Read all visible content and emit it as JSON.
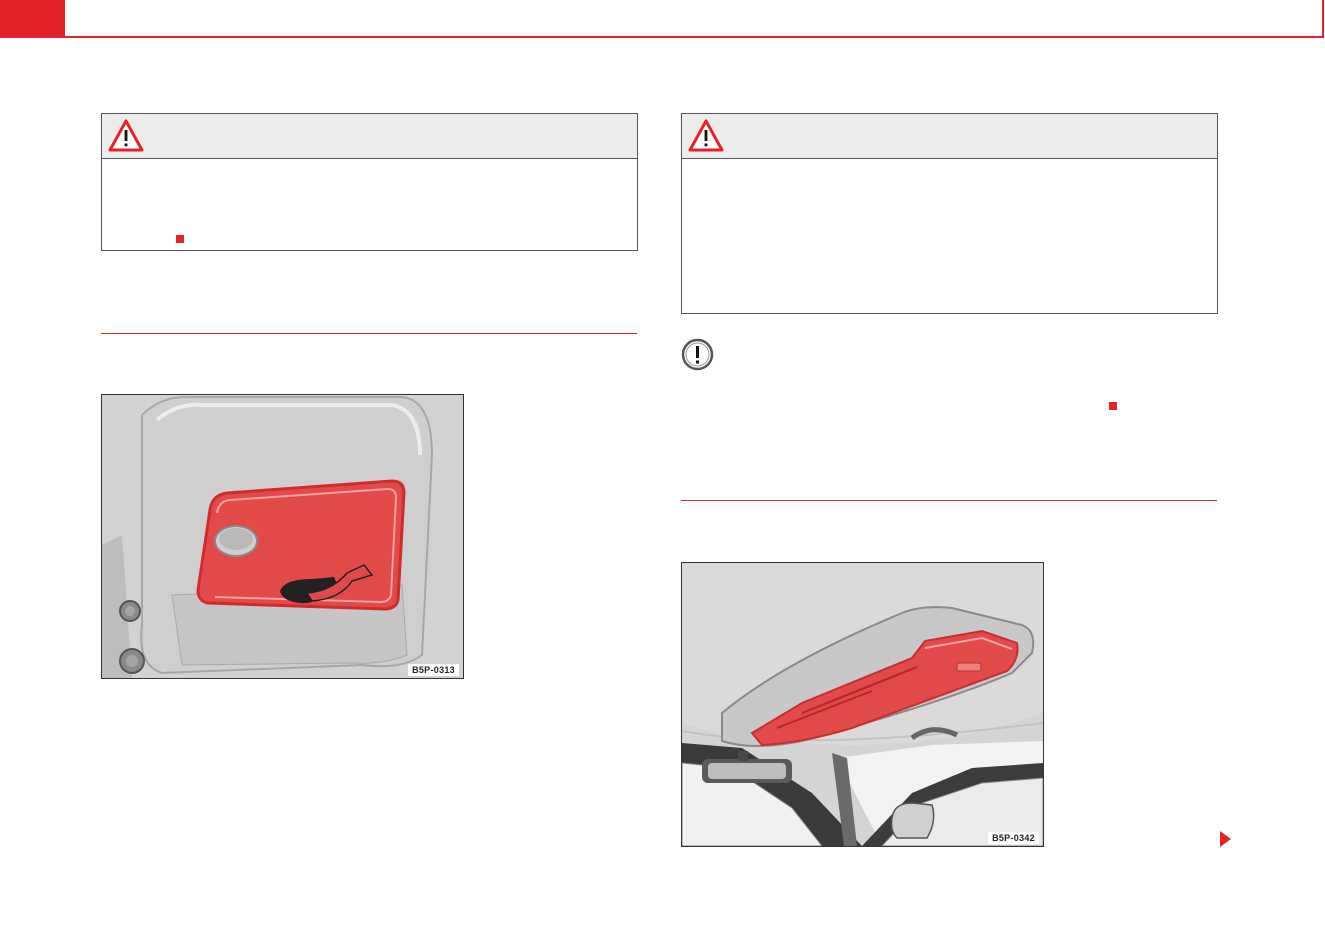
{
  "header": {
    "accent_color": "#e4222a"
  },
  "left_column": {
    "warning_box": {
      "icon": "warning-triangle-icon",
      "end_marker": "red-square"
    },
    "figure": {
      "code": "B5P-0313",
      "subject": "seat-back-storage-compartment"
    }
  },
  "right_column": {
    "warning_box": {
      "icon": "warning-triangle-icon"
    },
    "notice": {
      "icon": "exclamation-circle-icon",
      "end_marker": "red-square"
    },
    "figure": {
      "code": "B5P-0342",
      "subject": "roof-console-storage-compartments"
    },
    "continue_marker": "continue-arrow-icon"
  }
}
